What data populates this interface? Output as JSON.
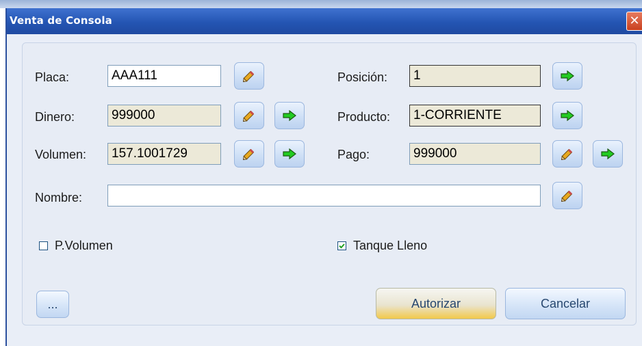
{
  "window": {
    "title": "Venta de Consola",
    "close_glyph": "✕"
  },
  "form": {
    "placa": {
      "label": "Placa:",
      "value": "AAA111"
    },
    "dinero": {
      "label": "Dinero:",
      "value": "999000"
    },
    "volumen": {
      "label": "Volumen:",
      "value": "157.1001729"
    },
    "posicion": {
      "label": "Posición:",
      "value": "1"
    },
    "producto": {
      "label": "Producto:",
      "value": "1-CORRIENTE"
    },
    "pago": {
      "label": "Pago:",
      "value": "999000"
    },
    "nombre": {
      "label": "Nombre:",
      "value": ""
    }
  },
  "options": {
    "p_volumen": {
      "label": "P.Volumen",
      "checked": false
    },
    "tanque_lleno": {
      "label": "Tanque Lleno",
      "checked": true
    }
  },
  "buttons": {
    "more": "...",
    "autorizar": "Autorizar",
    "cancelar": "Cancelar"
  },
  "icons": {
    "edit": "pencil-icon",
    "go": "green-arrow-icon"
  },
  "colors": {
    "titlebar": "#2455b3",
    "arrow": "#22cc22",
    "focus": "#f2c94a"
  }
}
